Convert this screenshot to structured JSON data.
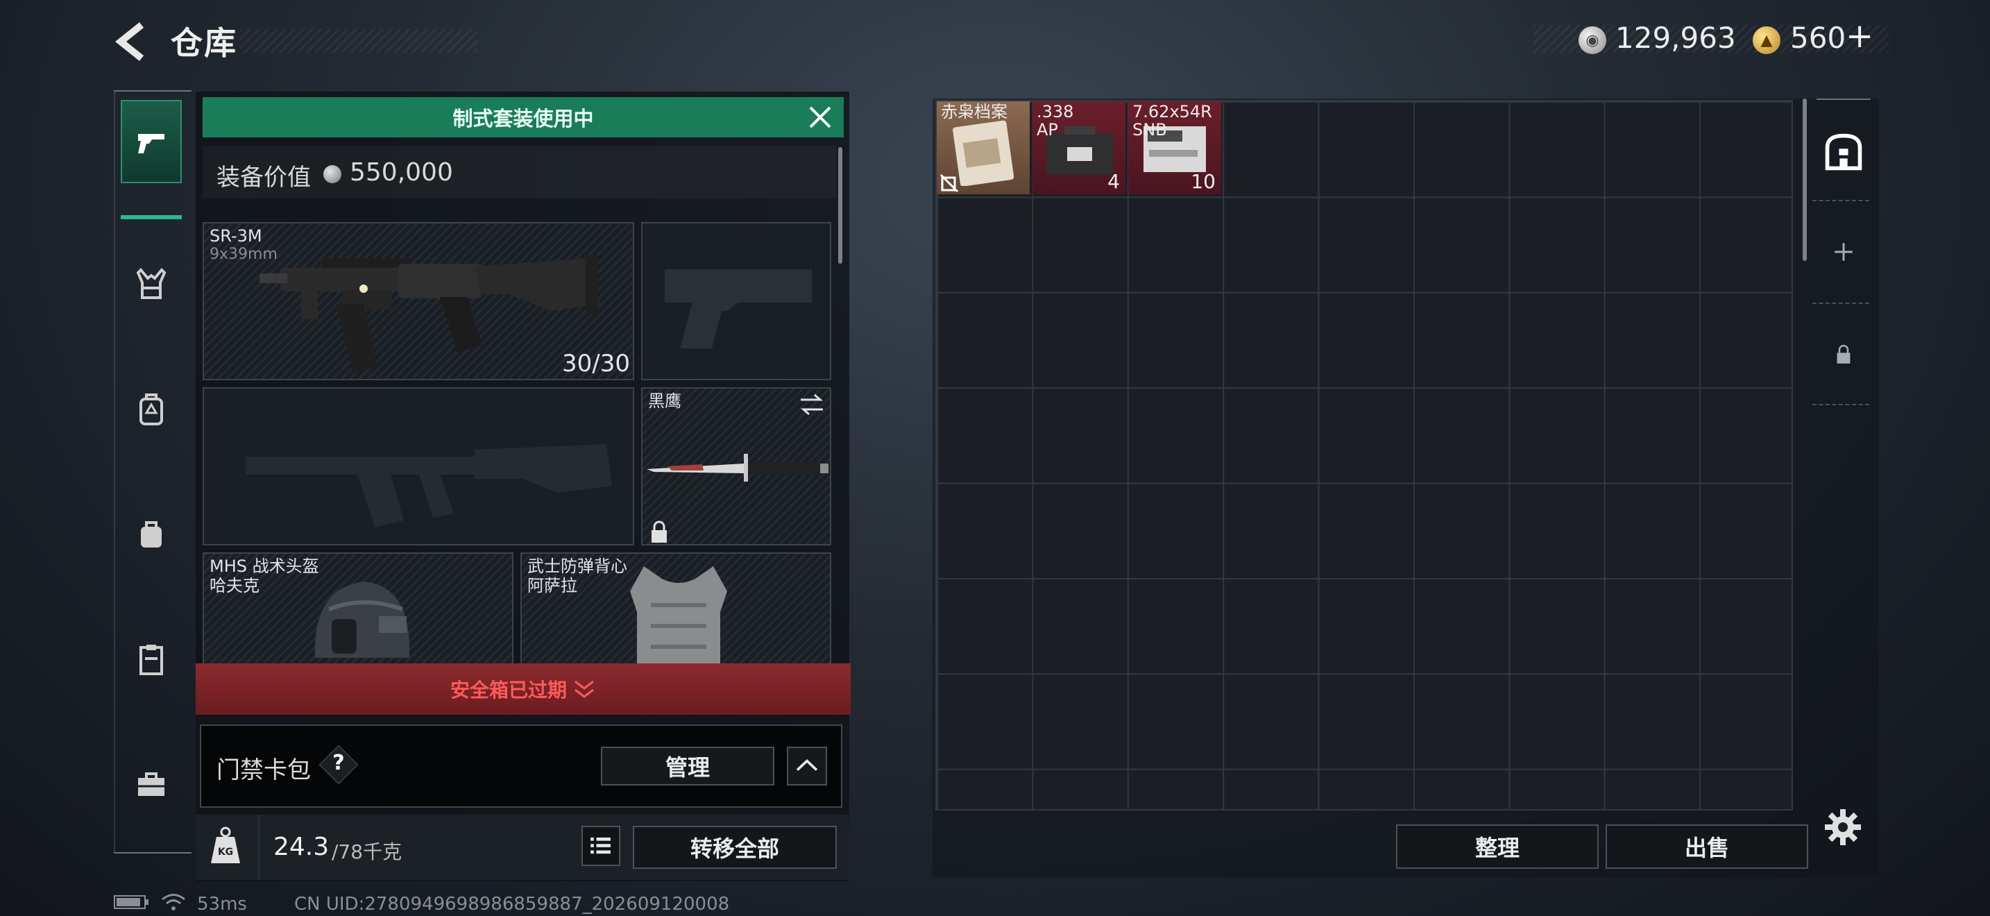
{
  "header": {
    "title": "仓库",
    "currency_silver": "129,963",
    "currency_gold": "560",
    "add_symbol": "+"
  },
  "loadout": {
    "banner": "制式套装使用中",
    "value_label": "装备价值",
    "value": "550,000",
    "slots": [
      {
        "name": "SR-3M",
        "sub": "9x39mm",
        "ammo": "30/30"
      },
      {
        "name": "黑鹰"
      },
      {
        "name": "MHS 战术头盔",
        "sub": "哈夫克"
      },
      {
        "name": "武士防弹背心",
        "sub": "阿萨拉"
      }
    ],
    "safebox_expired": "安全箱已过期",
    "card_label": "门禁卡包",
    "card_help": "?",
    "manage_label": "管理",
    "weight_current": "24.3",
    "weight_max": "/78千克",
    "weight_icon_text": "KG",
    "transfer_all_label": "转移全部"
  },
  "stash": {
    "items": [
      {
        "label": "赤枭档案",
        "count": ""
      },
      {
        "label": ".338\nAP",
        "count": "4"
      },
      {
        "label": "7.62x54R\nSNB",
        "count": "10"
      }
    ],
    "sort_label": "整理",
    "sell_label": "出售"
  },
  "status": {
    "ping": "53ms",
    "uid": "CN UID:2780949698986859887_202609120008"
  },
  "colors": {
    "accent_green": "#1a7d5a",
    "alert_red": "#8d2a2e",
    "item_red": "#6b1f2b"
  }
}
